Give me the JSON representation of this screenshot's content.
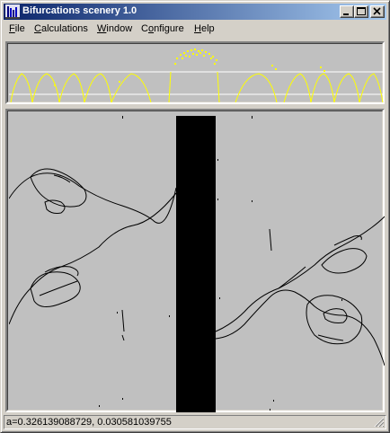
{
  "window": {
    "title": "Bifurcations scenery 1.0"
  },
  "menu": {
    "items": [
      {
        "label": "File",
        "accel": "F",
        "rest": "ile"
      },
      {
        "label": "Calculations",
        "accel": "C",
        "rest": "alculations"
      },
      {
        "label": "Window",
        "accel": "W",
        "rest": "indow"
      },
      {
        "label": "Configure",
        "accel": "o",
        "pre": "C",
        "rest": "nfigure"
      },
      {
        "label": "Help",
        "accel": "H",
        "rest": "elp"
      }
    ]
  },
  "colors": {
    "title_start": "#0a246a",
    "title_end": "#a6caf0",
    "plot_background": "#c0c0c0",
    "preview_curve": "#ffff00",
    "diagram_curve": "#000000"
  },
  "status": {
    "coordinates": "a=0.326139088729, 0.030581039755"
  }
}
